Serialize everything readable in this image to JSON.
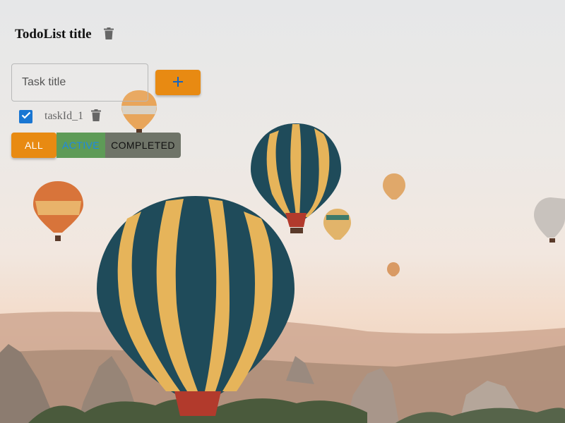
{
  "header": {
    "title": "TodoList title",
    "delete_icon": "trash-icon"
  },
  "new_task": {
    "placeholder": "Task title",
    "value": "",
    "add_icon": "plus-icon"
  },
  "tasks": [
    {
      "id": "taskId_1",
      "label": "taskId_1",
      "completed": true,
      "delete_icon": "trash-icon"
    }
  ],
  "filters": {
    "all": "ALL",
    "active": "ACTIVE",
    "completed": "COMPLETED",
    "selected": "all"
  },
  "colors": {
    "accent_orange": "#e88a12",
    "active_green": "#5e9b57",
    "completed_gray": "#6f7468",
    "checkbox_blue": "#1976d2",
    "active_text_blue": "#1e88e5"
  },
  "background": {
    "description_icon": "hot-air-balloons-image"
  }
}
